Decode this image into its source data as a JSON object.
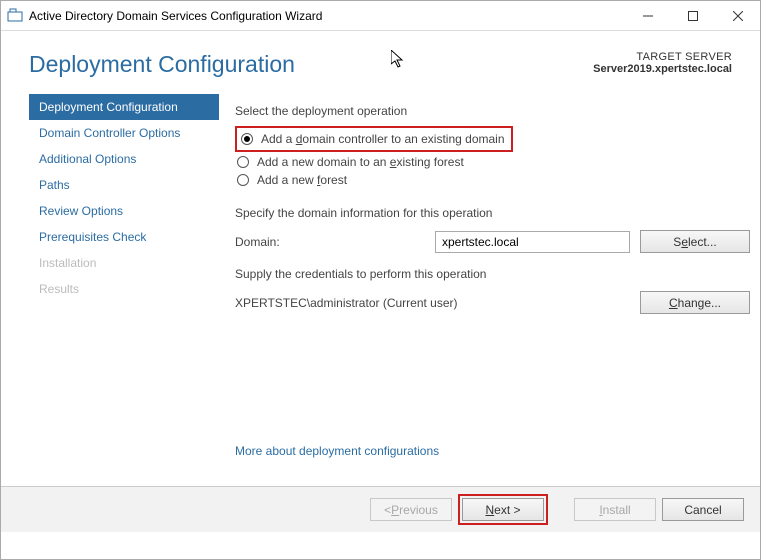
{
  "window": {
    "title": "Active Directory Domain Services Configuration Wizard"
  },
  "header": {
    "page_title": "Deployment Configuration",
    "target_label": "TARGET SERVER",
    "target_value": "Server2019.xpertstec.local"
  },
  "nav": {
    "items": [
      {
        "label": "Deployment Configuration",
        "state": "active"
      },
      {
        "label": "Domain Controller Options",
        "state": "normal"
      },
      {
        "label": "Additional Options",
        "state": "normal"
      },
      {
        "label": "Paths",
        "state": "normal"
      },
      {
        "label": "Review Options",
        "state": "normal"
      },
      {
        "label": "Prerequisites Check",
        "state": "normal"
      },
      {
        "label": "Installation",
        "state": "disabled"
      },
      {
        "label": "Results",
        "state": "disabled"
      }
    ]
  },
  "main": {
    "operation_label": "Select the deployment operation",
    "radio1_pre": "Add a ",
    "radio1_u": "d",
    "radio1_post": "omain controller to an existing domain",
    "radio2_pre": "Add a new domain to an ",
    "radio2_u": "e",
    "radio2_post": "xisting forest",
    "radio3_pre": "Add a new ",
    "radio3_u": "f",
    "radio3_post": "orest",
    "domain_info_label": "Specify the domain information for this operation",
    "domain_label": "Domain:",
    "domain_value": "xpertstec.local",
    "select_btn_pre": "S",
    "select_btn_u": "e",
    "select_btn_post": "lect...",
    "creds_label": "Supply the credentials to perform this operation",
    "creds_value": "XPERTSTEC\\administrator (Current user)",
    "change_btn_pre": "",
    "change_btn_u": "C",
    "change_btn_post": "hange...",
    "more_link": "More about deployment configurations"
  },
  "footer": {
    "prev_pre": "< ",
    "prev_u": "P",
    "prev_post": "revious",
    "next_pre": "",
    "next_u": "N",
    "next_post": "ext >",
    "install_pre": "",
    "install_u": "I",
    "install_post": "nstall",
    "cancel": "Cancel"
  }
}
